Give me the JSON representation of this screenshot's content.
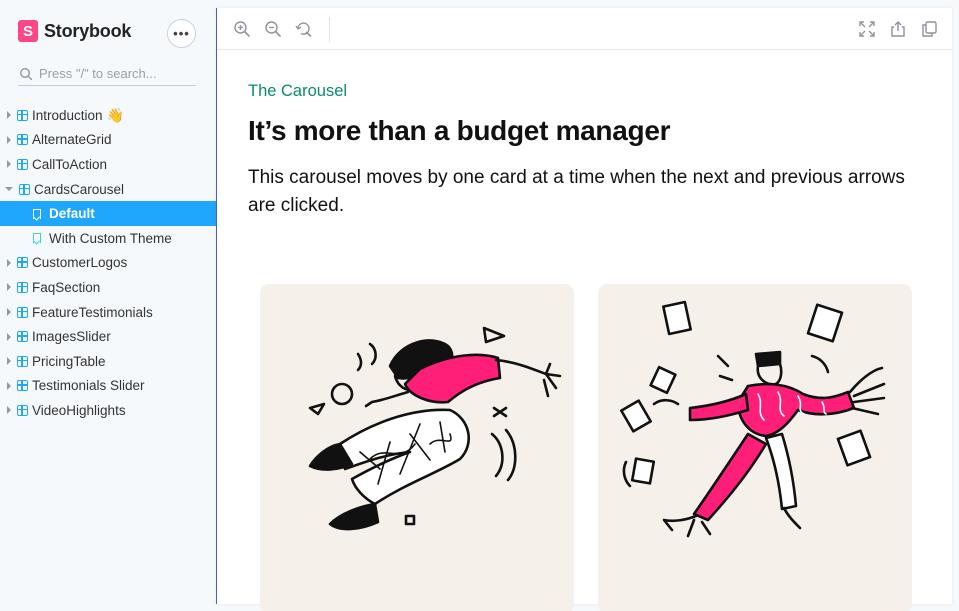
{
  "app": {
    "name": "Storybook",
    "logo_letter": "S",
    "menu_label": "•••"
  },
  "search": {
    "placeholder": "Press \"/\" to search..."
  },
  "tree": {
    "items": [
      {
        "label": "Introduction",
        "emoji": "👋"
      },
      {
        "label": "AlternateGrid"
      },
      {
        "label": "CallToAction"
      },
      {
        "label": "CardsCarousel"
      },
      {
        "label": "Default"
      },
      {
        "label": "With Custom Theme"
      },
      {
        "label": "CustomerLogos"
      },
      {
        "label": "FaqSection"
      },
      {
        "label": "FeatureTestimonials"
      },
      {
        "label": "ImagesSlider"
      },
      {
        "label": "PricingTable"
      },
      {
        "label": "Testimonials Slider"
      },
      {
        "label": "VideoHighlights"
      }
    ]
  },
  "preview": {
    "eyebrow": "The Carousel",
    "headline": "It’s more than a budget manager",
    "description": "This carousel moves by one card at a time when the next and previous arrows are clicked."
  },
  "colors": {
    "accent": "#1ea7fd",
    "brand": "#ff4785",
    "eyebrow": "#0b8b6b",
    "illustration_pink": "#ff1e78",
    "card_bg": "#f5f0ea"
  },
  "icons": [
    "zoom-in-icon",
    "zoom-out-icon",
    "reset-zoom-icon",
    "fullscreen-icon",
    "share-icon",
    "copy-icon",
    "search-icon",
    "component-icon",
    "bookmark-icon"
  ]
}
